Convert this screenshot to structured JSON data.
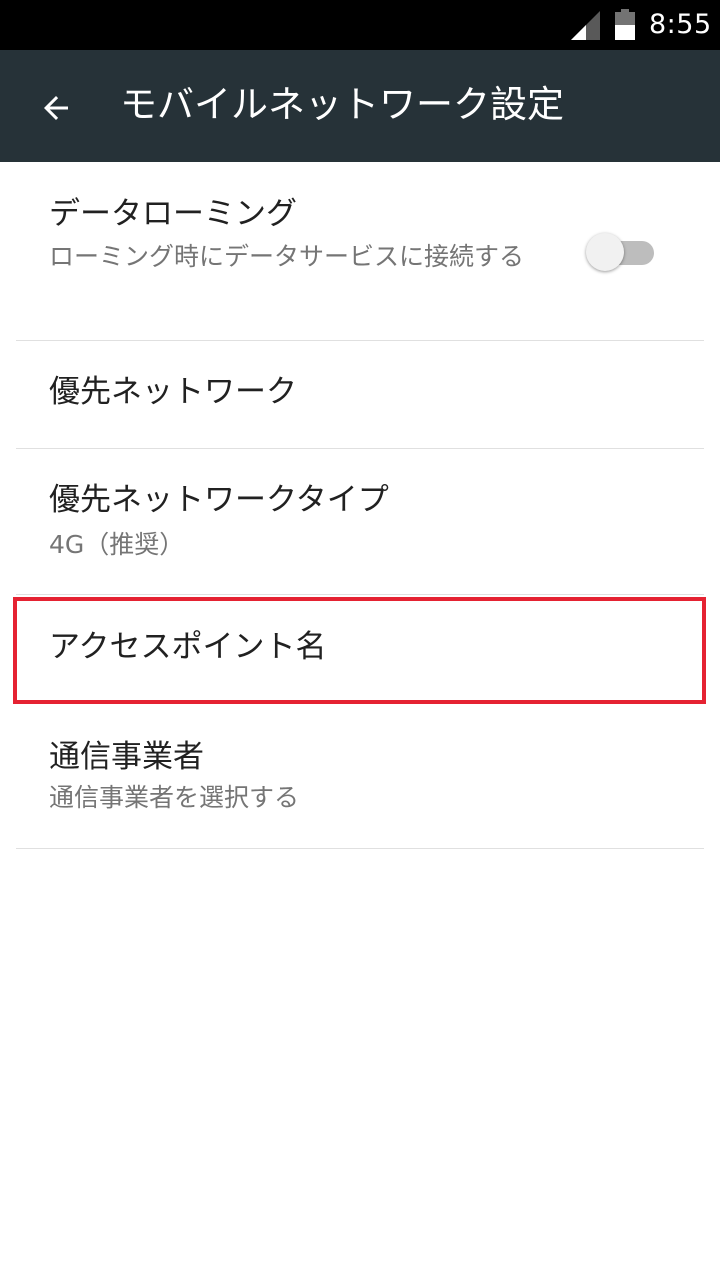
{
  "status_bar": {
    "time": "8:55",
    "signal_icon": "cell-signal-icon",
    "battery_icon": "battery-icon"
  },
  "app_bar": {
    "title": "モバイルネットワーク設定",
    "back_icon": "arrow-back-icon"
  },
  "settings": {
    "data_roaming": {
      "title": "データローミング",
      "summary": "ローミング時にデータサービスに接続する",
      "enabled": false
    },
    "preferred_network": {
      "title": "優先ネットワーク"
    },
    "preferred_network_type": {
      "title": "優先ネットワークタイプ",
      "summary": "4G（推奨）"
    },
    "access_point_name": {
      "title": "アクセスポイント名"
    },
    "carrier": {
      "title": "通信事業者",
      "summary": "通信事業者を選択する"
    }
  },
  "colors": {
    "app_bar_background": "#263238",
    "status_bar_background": "#000000",
    "highlight_border": "#e52232",
    "toggle_track_off": "#bdbdbd",
    "divider": "#e0e0e0"
  }
}
